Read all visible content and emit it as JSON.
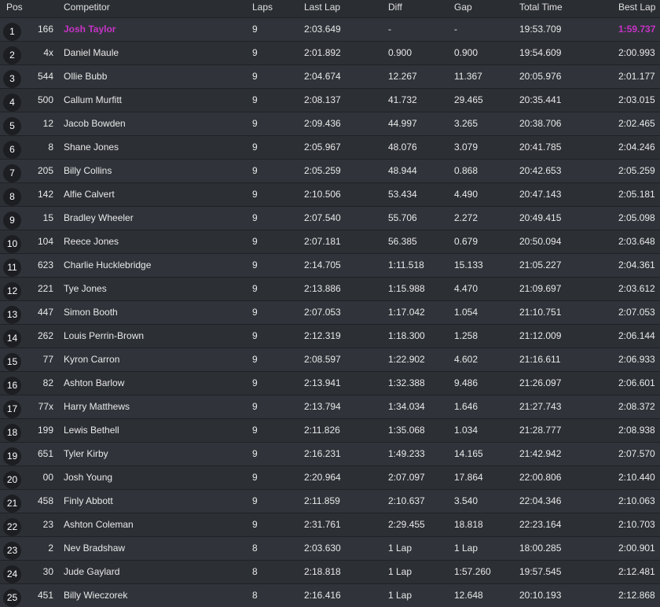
{
  "headers": {
    "pos": "Pos",
    "competitor": "Competitor",
    "laps": "Laps",
    "last_lap": "Last Lap",
    "diff": "Diff",
    "gap": "Gap",
    "total_time": "Total Time",
    "best_lap": "Best Lap"
  },
  "highlight_color": "#c832c8",
  "rows": [
    {
      "pos": "1",
      "num": "166",
      "name": "Josh Taylor",
      "laps": "9",
      "last": "2:03.649",
      "diff": "-",
      "gap": "-",
      "total": "19:53.709",
      "best": "1:59.737",
      "leader": true
    },
    {
      "pos": "2",
      "num": "4x",
      "name": "Daniel Maule",
      "laps": "9",
      "last": "2:01.892",
      "diff": "0.900",
      "gap": "0.900",
      "total": "19:54.609",
      "best": "2:00.993"
    },
    {
      "pos": "3",
      "num": "544",
      "name": "Ollie Bubb",
      "laps": "9",
      "last": "2:04.674",
      "diff": "12.267",
      "gap": "11.367",
      "total": "20:05.976",
      "best": "2:01.177"
    },
    {
      "pos": "4",
      "num": "500",
      "name": "Callum Murfitt",
      "laps": "9",
      "last": "2:08.137",
      "diff": "41.732",
      "gap": "29.465",
      "total": "20:35.441",
      "best": "2:03.015"
    },
    {
      "pos": "5",
      "num": "12",
      "name": "Jacob Bowden",
      "laps": "9",
      "last": "2:09.436",
      "diff": "44.997",
      "gap": "3.265",
      "total": "20:38.706",
      "best": "2:02.465"
    },
    {
      "pos": "6",
      "num": "8",
      "name": "Shane Jones",
      "laps": "9",
      "last": "2:05.967",
      "diff": "48.076",
      "gap": "3.079",
      "total": "20:41.785",
      "best": "2:04.246"
    },
    {
      "pos": "7",
      "num": "205",
      "name": "Billy Collins",
      "laps": "9",
      "last": "2:05.259",
      "diff": "48.944",
      "gap": "0.868",
      "total": "20:42.653",
      "best": "2:05.259"
    },
    {
      "pos": "8",
      "num": "142",
      "name": "Alfie Calvert",
      "laps": "9",
      "last": "2:10.506",
      "diff": "53.434",
      "gap": "4.490",
      "total": "20:47.143",
      "best": "2:05.181"
    },
    {
      "pos": "9",
      "num": "15",
      "name": "Bradley Wheeler",
      "laps": "9",
      "last": "2:07.540",
      "diff": "55.706",
      "gap": "2.272",
      "total": "20:49.415",
      "best": "2:05.098"
    },
    {
      "pos": "10",
      "num": "104",
      "name": "Reece Jones",
      "laps": "9",
      "last": "2:07.181",
      "diff": "56.385",
      "gap": "0.679",
      "total": "20:50.094",
      "best": "2:03.648"
    },
    {
      "pos": "11",
      "num": "623",
      "name": "Charlie Hucklebridge",
      "laps": "9",
      "last": "2:14.705",
      "diff": "1:11.518",
      "gap": "15.133",
      "total": "21:05.227",
      "best": "2:04.361"
    },
    {
      "pos": "12",
      "num": "221",
      "name": "Tye Jones",
      "laps": "9",
      "last": "2:13.886",
      "diff": "1:15.988",
      "gap": "4.470",
      "total": "21:09.697",
      "best": "2:03.612"
    },
    {
      "pos": "13",
      "num": "447",
      "name": "Simon Booth",
      "laps": "9",
      "last": "2:07.053",
      "diff": "1:17.042",
      "gap": "1.054",
      "total": "21:10.751",
      "best": "2:07.053"
    },
    {
      "pos": "14",
      "num": "262",
      "name": "Louis Perrin-Brown",
      "laps": "9",
      "last": "2:12.319",
      "diff": "1:18.300",
      "gap": "1.258",
      "total": "21:12.009",
      "best": "2:06.144"
    },
    {
      "pos": "15",
      "num": "77",
      "name": "Kyron Carron",
      "laps": "9",
      "last": "2:08.597",
      "diff": "1:22.902",
      "gap": "4.602",
      "total": "21:16.611",
      "best": "2:06.933"
    },
    {
      "pos": "16",
      "num": "82",
      "name": "Ashton Barlow",
      "laps": "9",
      "last": "2:13.941",
      "diff": "1:32.388",
      "gap": "9.486",
      "total": "21:26.097",
      "best": "2:06.601"
    },
    {
      "pos": "17",
      "num": "77x",
      "name": "Harry Matthews",
      "laps": "9",
      "last": "2:13.794",
      "diff": "1:34.034",
      "gap": "1.646",
      "total": "21:27.743",
      "best": "2:08.372"
    },
    {
      "pos": "18",
      "num": "199",
      "name": "Lewis Bethell",
      "laps": "9",
      "last": "2:11.826",
      "diff": "1:35.068",
      "gap": "1.034",
      "total": "21:28.777",
      "best": "2:08.938"
    },
    {
      "pos": "19",
      "num": "651",
      "name": "Tyler Kirby",
      "laps": "9",
      "last": "2:16.231",
      "diff": "1:49.233",
      "gap": "14.165",
      "total": "21:42.942",
      "best": "2:07.570"
    },
    {
      "pos": "20",
      "num": "00",
      "name": "Josh Young",
      "laps": "9",
      "last": "2:20.964",
      "diff": "2:07.097",
      "gap": "17.864",
      "total": "22:00.806",
      "best": "2:10.440"
    },
    {
      "pos": "21",
      "num": "458",
      "name": "Finly Abbott",
      "laps": "9",
      "last": "2:11.859",
      "diff": "2:10.637",
      "gap": "3.540",
      "total": "22:04.346",
      "best": "2:10.063"
    },
    {
      "pos": "22",
      "num": "23",
      "name": "Ashton Coleman",
      "laps": "9",
      "last": "2:31.761",
      "diff": "2:29.455",
      "gap": "18.818",
      "total": "22:23.164",
      "best": "2:10.703"
    },
    {
      "pos": "23",
      "num": "2",
      "name": "Nev Bradshaw",
      "laps": "8",
      "last": "2:03.630",
      "diff": "1 Lap",
      "gap": "1 Lap",
      "total": "18:00.285",
      "best": "2:00.901"
    },
    {
      "pos": "24",
      "num": "30",
      "name": "Jude Gaylard",
      "laps": "8",
      "last": "2:18.818",
      "diff": "1 Lap",
      "gap": "1:57.260",
      "total": "19:57.545",
      "best": "2:12.481"
    },
    {
      "pos": "25",
      "num": "451",
      "name": "Billy Wieczorek",
      "laps": "8",
      "last": "2:16.416",
      "diff": "1 Lap",
      "gap": "12.648",
      "total": "20:10.193",
      "best": "2:12.868"
    }
  ]
}
